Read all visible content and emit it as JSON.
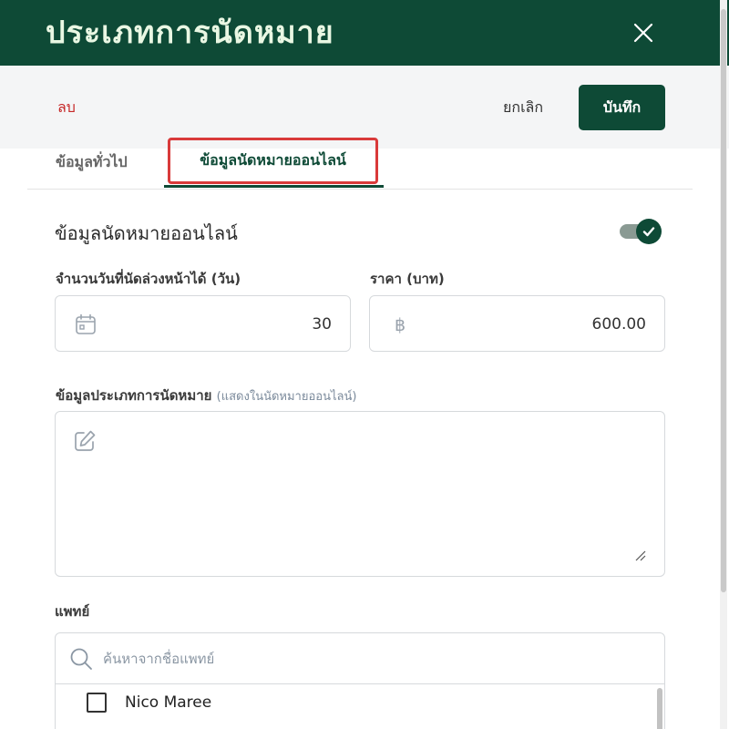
{
  "header": {
    "title": "ประเภทการนัดหมาย",
    "close_icon": "close-icon"
  },
  "actions": {
    "delete_label": "ลบ",
    "cancel_label": "ยกเลิก",
    "save_label": "บันทึก"
  },
  "tabs": [
    {
      "label": "ข้อมูลทั่วไป",
      "active": false
    },
    {
      "label": "ข้อมูลนัดหมายออนไลน์",
      "active": true
    }
  ],
  "online": {
    "section_title": "ข้อมูลนัดหมายออนไลน์",
    "enabled": true,
    "days_label": "จำนวนวันที่นัดล่วงหน้าได้ (วัน)",
    "days_value": "30",
    "days_icon": "calendar-icon",
    "price_label": "ราคา (บาท)",
    "price_value": "600.00",
    "price_icon": "baht-icon",
    "description_label": "ข้อมูลประเภทการนัดหมาย",
    "description_hint": "(แสดงในนัดหมายออนไลน์)",
    "description_value": "",
    "description_icon": "edit-icon"
  },
  "doctors": {
    "label": "แพทย์",
    "search_placeholder": "ค้นหาจากชื่อแพทย์",
    "search_icon": "search-icon",
    "items": [
      {
        "name": "Nico Maree",
        "checked": false
      }
    ]
  },
  "colors": {
    "brand": "#0e4a36",
    "header_text": "#e9f7e3",
    "delete": "#c62828",
    "highlight": "#d93a3a",
    "muted_hint": "#7b8a9b"
  }
}
